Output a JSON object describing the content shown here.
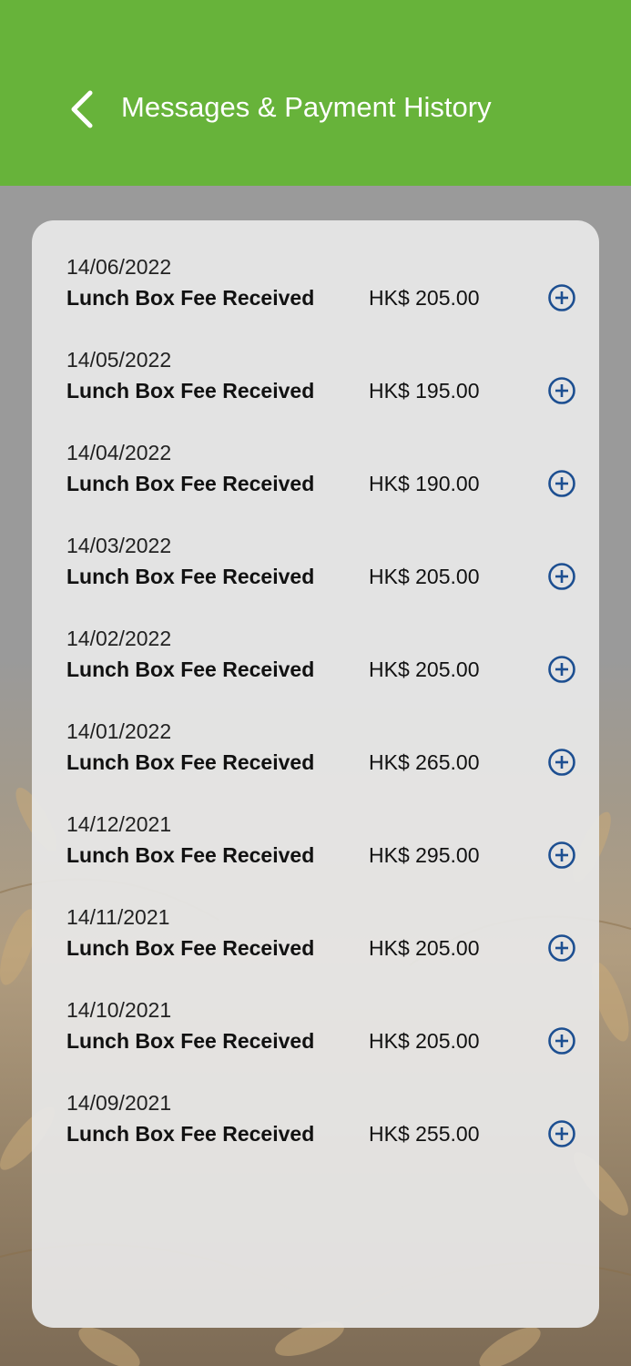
{
  "header": {
    "title": "Messages & Payment History",
    "back_icon": "chevron-left-icon",
    "color": "#67b33a"
  },
  "colors": {
    "accent_icon": "#1d4f91",
    "card_bg": "#e8e8e8"
  },
  "payments": [
    {
      "date": "14/06/2022",
      "label": "Lunch Box Fee Received",
      "amount": "HK$ 205.00",
      "icon": "plus-circle-icon"
    },
    {
      "date": "14/05/2022",
      "label": "Lunch Box Fee Received",
      "amount": "HK$ 195.00",
      "icon": "plus-circle-icon"
    },
    {
      "date": "14/04/2022",
      "label": "Lunch Box Fee Received",
      "amount": "HK$ 190.00",
      "icon": "plus-circle-icon"
    },
    {
      "date": "14/03/2022",
      "label": "Lunch Box Fee Received",
      "amount": "HK$ 205.00",
      "icon": "plus-circle-icon"
    },
    {
      "date": "14/02/2022",
      "label": "Lunch Box Fee Received",
      "amount": "HK$ 205.00",
      "icon": "plus-circle-icon"
    },
    {
      "date": "14/01/2022",
      "label": "Lunch Box Fee Received",
      "amount": "HK$ 265.00",
      "icon": "plus-circle-icon"
    },
    {
      "date": "14/12/2021",
      "label": "Lunch Box Fee Received",
      "amount": "HK$ 295.00",
      "icon": "plus-circle-icon"
    },
    {
      "date": "14/11/2021",
      "label": "Lunch Box Fee Received",
      "amount": "HK$ 205.00",
      "icon": "plus-circle-icon"
    },
    {
      "date": "14/10/2021",
      "label": "Lunch Box Fee Received",
      "amount": "HK$ 205.00",
      "icon": "plus-circle-icon"
    },
    {
      "date": "14/09/2021",
      "label": "Lunch Box Fee Received",
      "amount": "HK$ 255.00",
      "icon": "plus-circle-icon"
    }
  ]
}
